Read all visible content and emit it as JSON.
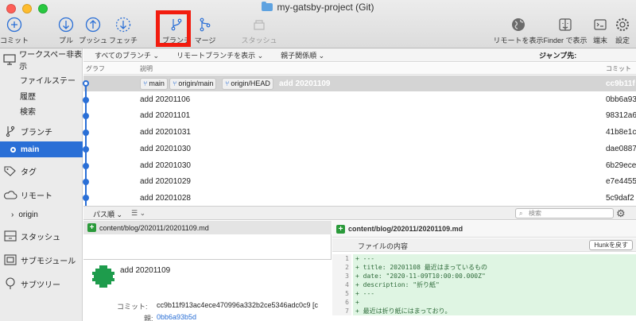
{
  "window": {
    "title": "my-gatsby-project (Git)"
  },
  "toolbar": {
    "commit": "コミット",
    "pull": "プル",
    "push": "プッシュ",
    "fetch": "フェッチ",
    "branch": "ブランチ",
    "merge": "マージ",
    "stash": "スタッシュ",
    "show_remote": "リモートを表示",
    "show_in_finder": "Finder で表示",
    "terminal": "端末",
    "settings": "設定"
  },
  "sidebar": {
    "hide_workspace": "ワークスペー非表示",
    "workspace_items": [
      "ファイルステー",
      "履歴",
      "検索"
    ],
    "branches": "ブランチ",
    "current_branch": "main",
    "tags": "タグ",
    "remotes": "リモート",
    "remote_origin": "origin",
    "stashes": "スタッシュ",
    "submodules": "サブモジュール",
    "subtrees": "サブツリー"
  },
  "filters": {
    "all_branches": "すべてのブランチ ⌄",
    "show_remote_branches": "リモートブランチを表示 ⌄",
    "parent_order": "親子関係順 ⌄",
    "jump_to": "ジャンプ先:"
  },
  "columns": {
    "graph": "グラフ",
    "description": "説明",
    "commit": "コミット"
  },
  "commits": [
    {
      "message": "add 20201109",
      "hash": "cc9b11f",
      "selected": true,
      "badges": [
        "main",
        "origin/main",
        "origin/HEAD"
      ]
    },
    {
      "message": "add 20201106",
      "hash": "0bb6a93"
    },
    {
      "message": "add 20201101",
      "hash": "98312a6"
    },
    {
      "message": "add 20201031",
      "hash": "41b8e1c"
    },
    {
      "message": "add 20201030",
      "hash": "dae0887"
    },
    {
      "message": "add 20201030",
      "hash": "6b29ece"
    },
    {
      "message": "add 20201029",
      "hash": "e7e4455"
    },
    {
      "message": "add 20201028",
      "hash": "5c9daf2"
    }
  ],
  "lower": {
    "path_view": "パス順 ⌄",
    "list_icon": "☰ ⌄",
    "search_placeholder": "検索",
    "file_path": "content/blog/202011/20201109.md"
  },
  "commit_detail": {
    "message": "add 20201109",
    "commit_label": "コミット:",
    "commit_hash": "cc9b11f913ac4ece470996a332b2ce5346adc0c9 [c",
    "parent_label": "親:",
    "parent_hash": "0bb6a93b5d"
  },
  "diff": {
    "file_path": "content/blog/202011/20201109.md",
    "hunk_title": "ファイルの内容",
    "hunk_button": "Hunkを戻す",
    "lines": [
      {
        "n": "1",
        "text": "+ ---"
      },
      {
        "n": "2",
        "text": "+ title: 20201108 最近はまっているもの"
      },
      {
        "n": "3",
        "text": "+ date: \"2020-11-09T10:00:00.000Z\""
      },
      {
        "n": "4",
        "text": "+ description: \"折り紙\""
      },
      {
        "n": "5",
        "text": "+ ---"
      },
      {
        "n": "6",
        "text": "+"
      },
      {
        "n": "7",
        "text": "+ 最近は折り紙にはまっており。"
      }
    ]
  }
}
